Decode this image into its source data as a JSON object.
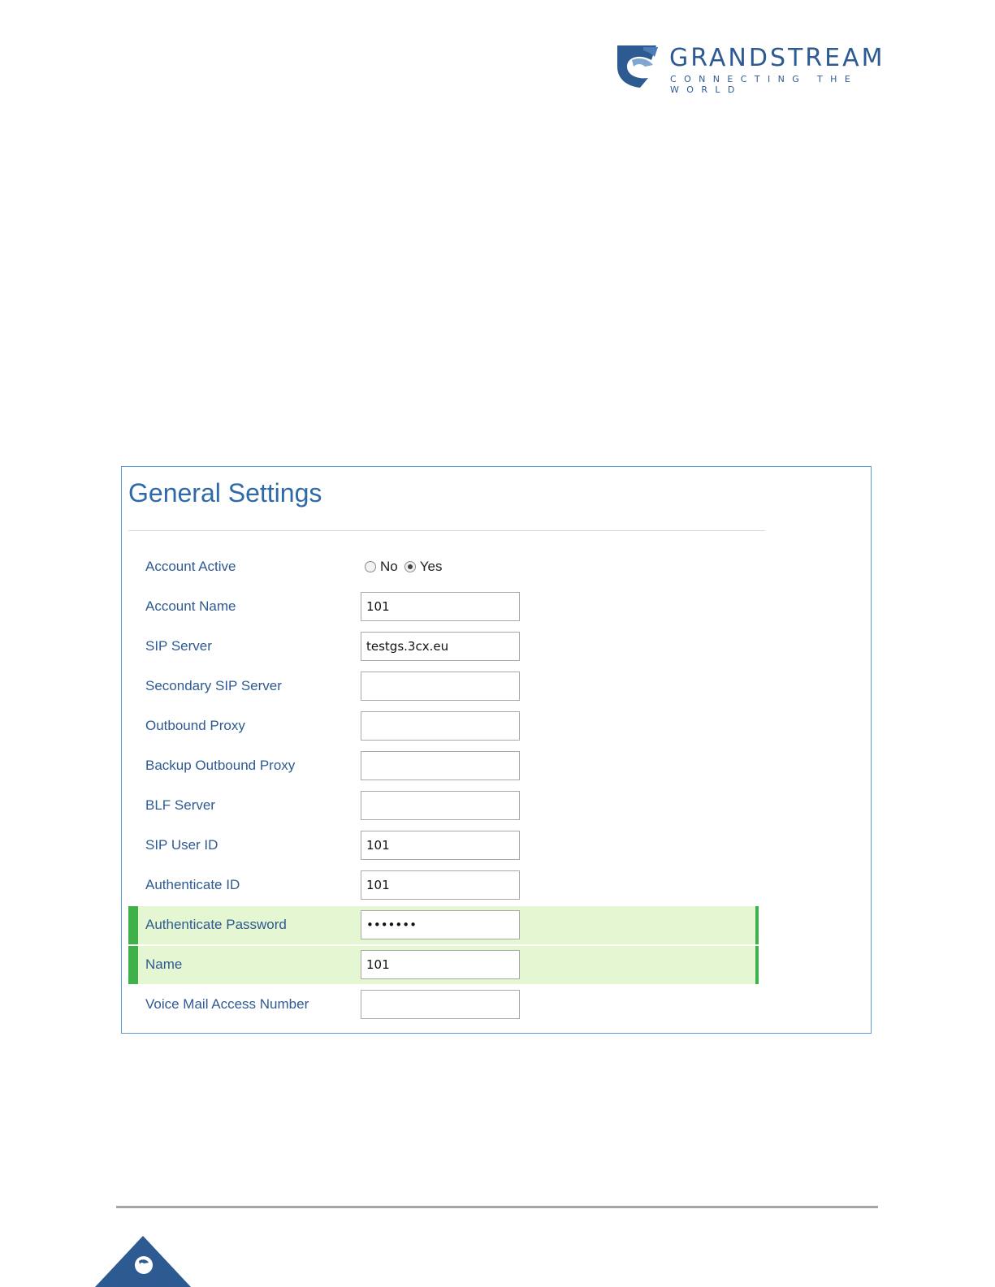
{
  "brand": {
    "name": "GRANDSTREAM",
    "tagline": "CONNECTING THE WORLD",
    "color": "#2e5a92"
  },
  "panel": {
    "title": "General Settings",
    "border_color": "#5b9bd5",
    "highlight_color": "#e5f6d2",
    "highlight_bar_color": "#3fb04a",
    "account_active": {
      "label": "Account Active",
      "options": [
        "No",
        "Yes"
      ],
      "selected": "Yes"
    },
    "fields": [
      {
        "label": "Account Name",
        "value": "101",
        "highlight": false
      },
      {
        "label": "SIP Server",
        "value": "testgs.3cx.eu",
        "highlight": false
      },
      {
        "label": "Secondary SIP Server",
        "value": "",
        "highlight": false
      },
      {
        "label": "Outbound Proxy",
        "value": "",
        "highlight": false
      },
      {
        "label": "Backup Outbound Proxy",
        "value": "",
        "highlight": false
      },
      {
        "label": "BLF Server",
        "value": "",
        "highlight": false
      },
      {
        "label": "SIP User ID",
        "value": "101",
        "highlight": false
      },
      {
        "label": "Authenticate ID",
        "value": "101",
        "highlight": false
      },
      {
        "label": "Authenticate Password",
        "value": "•••••••",
        "highlight": true
      },
      {
        "label": "Name",
        "value": "101",
        "highlight": true
      },
      {
        "label": "Voice Mail Access Number",
        "value": "",
        "highlight": false
      }
    ]
  }
}
